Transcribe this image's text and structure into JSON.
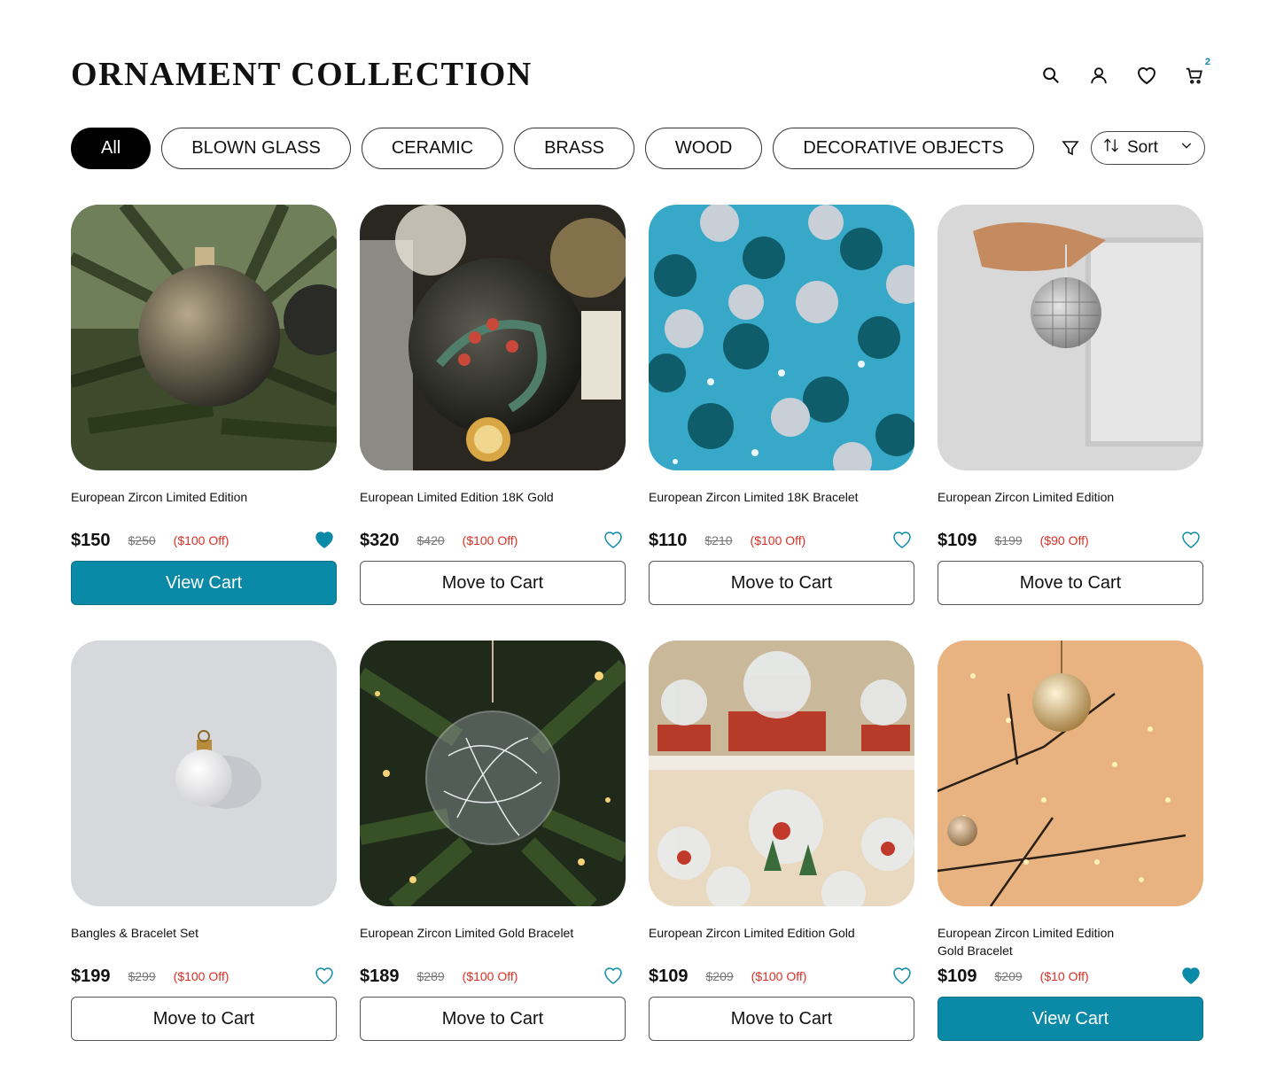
{
  "header": {
    "title": "ORNAMENT COLLECTION",
    "cart_count": "2"
  },
  "filters": [
    "All",
    "BLOWN GLASS",
    "CERAMIC",
    "BRASS",
    "WOOD",
    "DECORATIVE OBJECTS"
  ],
  "sort": {
    "label": "Sort"
  },
  "colors": {
    "accent": "#0b8aa8",
    "discount": "#d93025"
  },
  "products": [
    {
      "name": "European Zircon Limited Edition",
      "price": "$150",
      "old": "$250",
      "off": "($100 Off)",
      "button": "View Cart",
      "favorited": true,
      "image": "bronze-ornament-on-fir-tree"
    },
    {
      "name": "European  Limited Edition 18K Gold",
      "price": "$320",
      "old": "$420",
      "off": "($100 Off)",
      "button": "Move to Cart",
      "favorited": false,
      "image": "painted-glass-ornament-with-dried-orange"
    },
    {
      "name": "European Zircon Limited  18K  Bracelet",
      "price": "$110",
      "old": "$210",
      "off": "($100 Off)",
      "button": "Move to Cart",
      "favorited": false,
      "image": "teal-and-silver-mini-baubles"
    },
    {
      "name": "European Zircon Limited Edition",
      "price": "$109",
      "old": "$199",
      "off": "($90 Off)",
      "button": "Move to Cart",
      "favorited": false,
      "image": "hand-holding-disco-ball-ornament"
    },
    {
      "name": "Bangles & Bracelet Set",
      "price": "$199",
      "old": "$299",
      "off": "($100 Off)",
      "button": "Move to Cart",
      "favorited": false,
      "image": "white-ornament-on-grey"
    },
    {
      "name": "European Zircon Limited  Gold Bracelet",
      "price": "$189",
      "old": "$289",
      "off": "($100 Off)",
      "button": "Move to Cart",
      "favorited": false,
      "image": "clear-glass-ornament-on-tree"
    },
    {
      "name": "European Zircon Limited Edition Gold",
      "price": "$109",
      "old": "$209",
      "off": "($100 Off)",
      "button": "Move to Cart",
      "favorited": false,
      "image": "snow-globes-on-shelves"
    },
    {
      "name": "European Zircon Limited Edition\n Gold Bracelet",
      "price": "$109",
      "old": "$209",
      "off": "($10 Off)",
      "button": "View Cart",
      "favorited": true,
      "image": "gold-ornaments-on-branch-with-lights"
    }
  ]
}
